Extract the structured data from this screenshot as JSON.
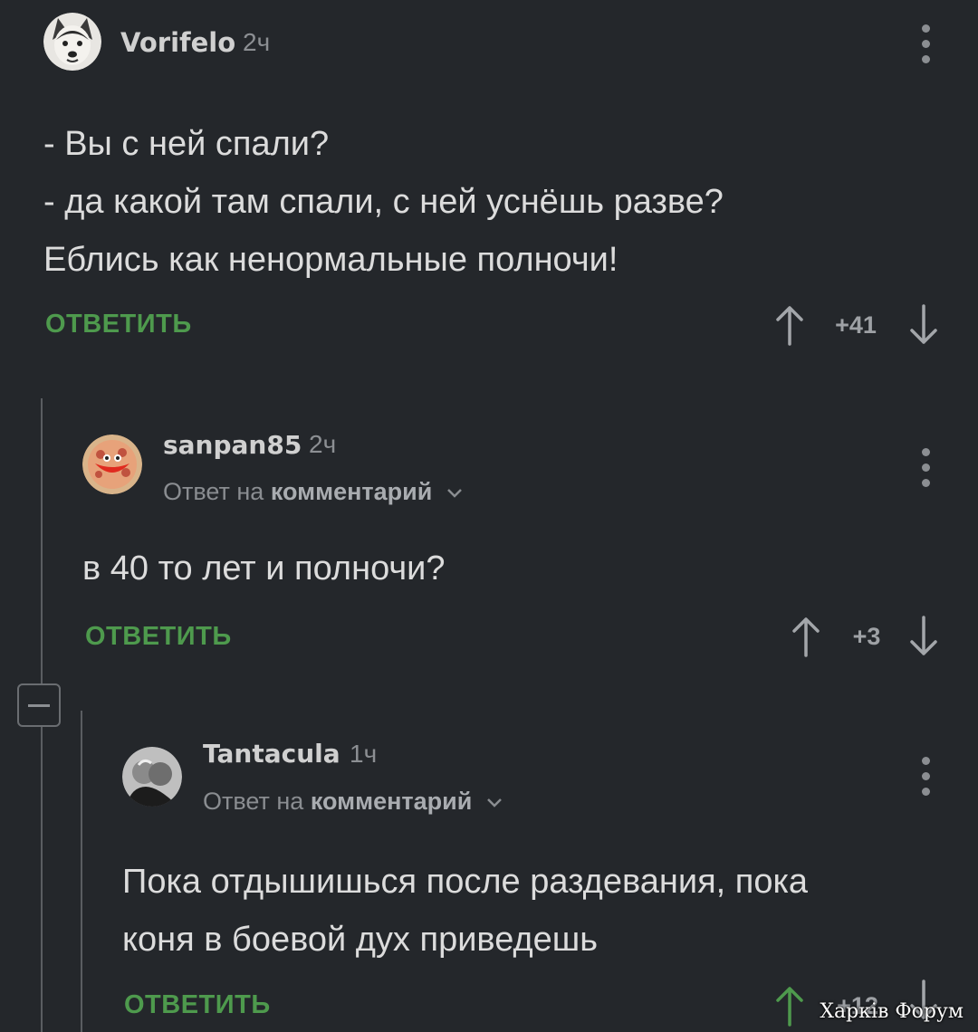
{
  "comments": [
    {
      "username": "Vorifelo",
      "time": "2ч",
      "lines": [
        "- Вы с ней спали?",
        "- да какой там спали, с ней уснёшь разве?",
        "Еблись как ненормальные полночи!"
      ],
      "reply_label": "ОТВЕТИТЬ",
      "score": "+41"
    },
    {
      "username": "sanpan85",
      "time": "2ч",
      "reply_prefix": "Ответ на",
      "reply_target": "комментарий",
      "lines": [
        "в 40 то лет и полночи?"
      ],
      "reply_label": "ОТВЕТИТЬ",
      "score": "+3"
    },
    {
      "username": "Tantacula",
      "time": "1ч",
      "reply_prefix": "Ответ на",
      "reply_target": "комментарий",
      "lines": [
        "Пока отдышишься после раздевания, пока",
        "коня в боевой дух приведешь"
      ],
      "reply_label": "ОТВЕТИТЬ",
      "score": "+12"
    }
  ],
  "watermark": "Харків Форум",
  "colors": {
    "background": "#24272b",
    "accent_green": "#4e9a4d",
    "text": "#dcdcdc",
    "muted": "#8c8f93"
  },
  "icons": [
    "upvote-arrow-icon",
    "downvote-arrow-icon",
    "more-options-icon",
    "chevron-down-icon",
    "collapse-thread-icon"
  ]
}
